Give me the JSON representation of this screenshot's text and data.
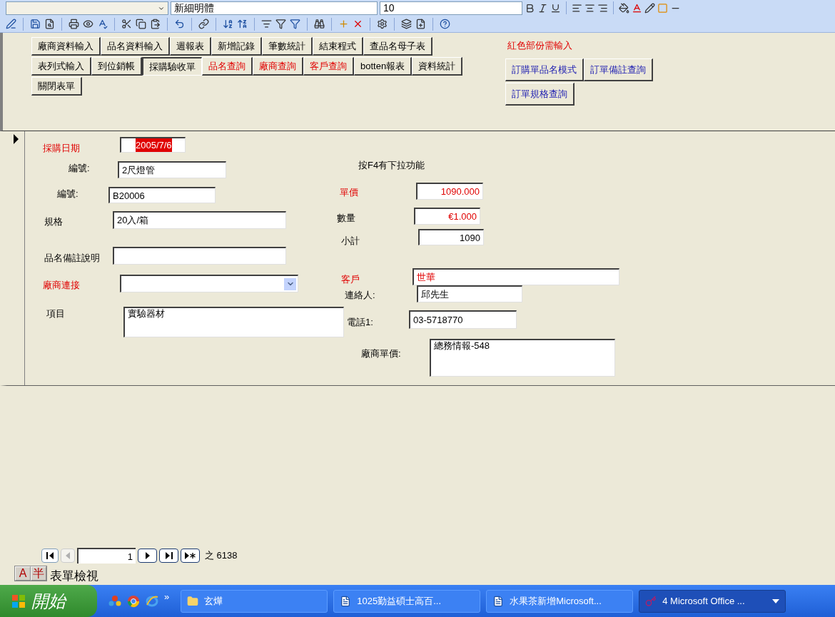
{
  "format_toolbar": {
    "font_box": "新細明體",
    "size_box": "10"
  },
  "header": {
    "button_rows": [
      [
        {
          "label": "廠商資料輸入",
          "kind": "normal",
          "selected": false
        },
        {
          "label": "品名資料輸入",
          "kind": "normal",
          "selected": false
        },
        {
          "label": "週報表",
          "kind": "normal",
          "selected": false
        },
        {
          "label": "新增記錄",
          "kind": "normal",
          "selected": false
        },
        {
          "label": "筆數統計",
          "kind": "normal",
          "selected": false
        },
        {
          "label": "結束程式",
          "kind": "normal",
          "selected": false
        },
        {
          "label": "查品名母子表",
          "kind": "normal",
          "selected": false
        }
      ],
      [
        {
          "label": "表列式輸入",
          "kind": "normal",
          "selected": false
        },
        {
          "label": "到位銷帳",
          "kind": "normal",
          "selected": false
        },
        {
          "label": "採購驗收單",
          "kind": "normal",
          "selected": true
        },
        {
          "label": "品名查詢",
          "kind": "required",
          "selected": false
        },
        {
          "label": "廠商查詢",
          "kind": "required",
          "selected": false
        },
        {
          "label": "客戶查詢",
          "kind": "required",
          "selected": false
        },
        {
          "label": "botten報表",
          "kind": "normal",
          "selected": false
        },
        {
          "label": "資料統計",
          "kind": "normal",
          "selected": false
        }
      ],
      [
        {
          "label": "關閉表單",
          "kind": "normal",
          "selected": false
        }
      ]
    ],
    "note": "紅色部份需輸入",
    "query_buttons": [
      "訂購單品名模式",
      "訂單備註查詢",
      "訂單規格查詢"
    ]
  },
  "record": {
    "current": true,
    "fields": [
      {
        "kind": "date",
        "label": "採購日期",
        "required": true,
        "value": "2005/7/6"
      },
      {
        "kind": "text",
        "label": "編號:",
        "required": false,
        "value": "2尺燈管"
      },
      {
        "kind": "text",
        "label": "編號:",
        "required": false,
        "value": "B20006"
      },
      {
        "kind": "text",
        "label": "規格",
        "required": false,
        "value": "20入/箱"
      },
      {
        "kind": "text",
        "label": "品名備註說明",
        "required": false
      },
      {
        "kind": "combo",
        "label": "廠商連接",
        "required": true
      },
      {
        "kind": "memo",
        "label": "項目",
        "required": false,
        "value": "實驗器材"
      },
      {
        "kind": "hint",
        "label": "按F4有下拉功能"
      },
      {
        "kind": "number",
        "label": "單價",
        "required": true,
        "value": "1090.000",
        "highlighted": true
      },
      {
        "kind": "number",
        "label": "數量",
        "required": false,
        "value": "€1.000",
        "highlighted": true
      },
      {
        "kind": "number",
        "label": "小計",
        "required": false,
        "value": "1090",
        "highlighted": false
      },
      {
        "kind": "text",
        "label": "客戶",
        "required": true,
        "value": "世華",
        "highlighted": true
      },
      {
        "kind": "text",
        "label": "連絡人:",
        "required": false,
        "value": "邱先生"
      },
      {
        "kind": "text",
        "label": "電話1:",
        "required": false,
        "value": "03-5718770"
      },
      {
        "kind": "memo",
        "label": "廠商單價:",
        "required": false,
        "value": "總務情報-548"
      }
    ]
  },
  "navigator": {
    "record_number": "1",
    "total": "之 6138",
    "prev_disabled": true
  },
  "ime_bar": [
    "A",
    "半"
  ],
  "status_bar": "表單檢視",
  "taskbar": {
    "start": "開始",
    "overflow": "»",
    "tasks": [
      {
        "kind": "folder",
        "label": "玄燁",
        "selected": false
      },
      {
        "kind": "word",
        "label": "1025勤益碩士高百...",
        "selected": false
      },
      {
        "kind": "word",
        "label": "水果茶新增Microsoft...",
        "selected": false
      },
      {
        "kind": "access",
        "label": "4 Microsoft Office ...",
        "selected": true
      }
    ]
  }
}
